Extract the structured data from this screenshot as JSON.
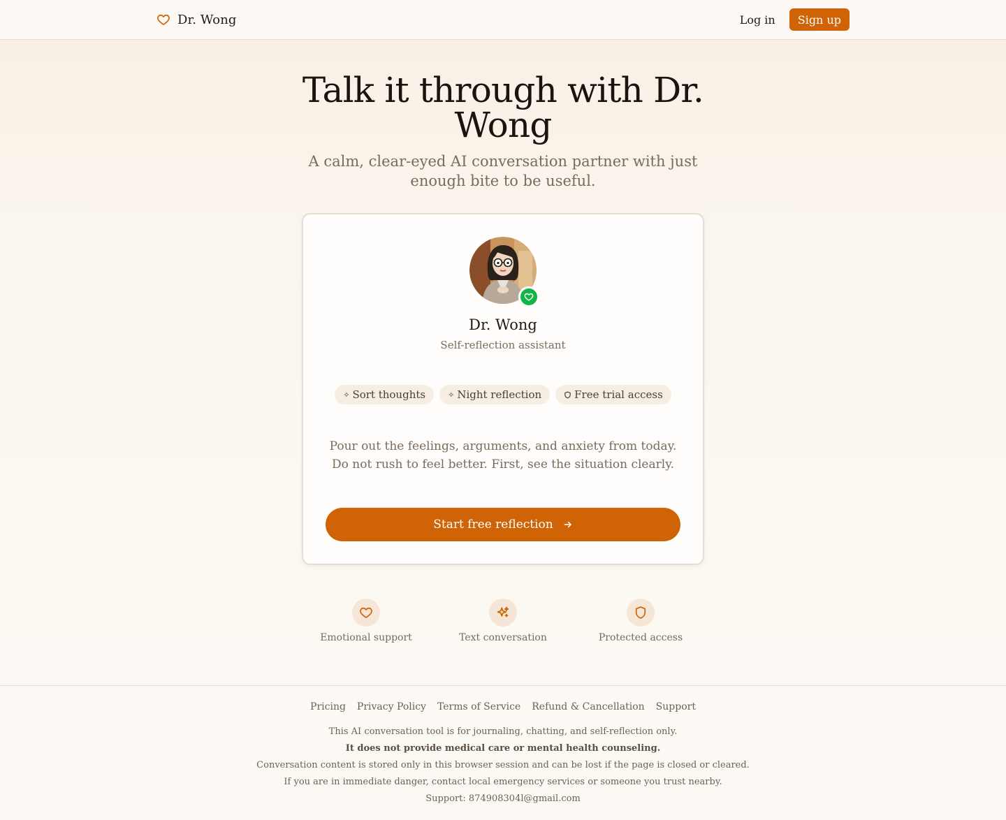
{
  "header": {
    "brand_name": "Dr. Wong",
    "brand_icon": "heart-icon",
    "login_label": "Log in",
    "signup_label": "Sign up"
  },
  "hero": {
    "title": "Talk it through with Dr. Wong",
    "subtitle": "A calm, clear-eyed AI conversation partner with just enough bite to be useful."
  },
  "card": {
    "avatar_badge_icon": "heart-icon",
    "name": "Dr. Wong",
    "role": "Self-reflection assistant",
    "chips": [
      {
        "icon": "sparkle-icon",
        "label": "Sort thoughts"
      },
      {
        "icon": "sparkle-icon",
        "label": "Night reflection"
      },
      {
        "icon": "shield-icon",
        "label": "Free trial access"
      }
    ],
    "pitch_line_1": "Pour out the feelings, arguments, and anxiety from today.",
    "pitch_line_2": "Do not rush to feel better. First, see the situation clearly.",
    "cta_label": "Start free reflection",
    "cta_icon": "arrow-right-icon"
  },
  "features": [
    {
      "icon": "heart-icon",
      "label": "Emotional support"
    },
    {
      "icon": "sparkles-icon",
      "label": "Text conversation"
    },
    {
      "icon": "shield-icon",
      "label": "Protected access"
    }
  ],
  "footer": {
    "links": [
      "Pricing",
      "Privacy Policy",
      "Terms of Service",
      "Refund & Cancellation",
      "Support"
    ],
    "lines": [
      "This AI conversation tool is for journaling, chatting, and self-reflection only.",
      "It does not provide medical care or mental health counseling.",
      "Conversation content is stored only in this browser session and can be lost if the page is closed or cleared.",
      "If you are in immediate danger, contact local emergency services or someone you trust nearby.",
      "Support: 874908304l@gmail.com"
    ]
  },
  "colors": {
    "accent": "#cf6306",
    "badge_green": "#10b546",
    "background": "#fcf9f4",
    "text_muted": "#7a6a5b"
  }
}
